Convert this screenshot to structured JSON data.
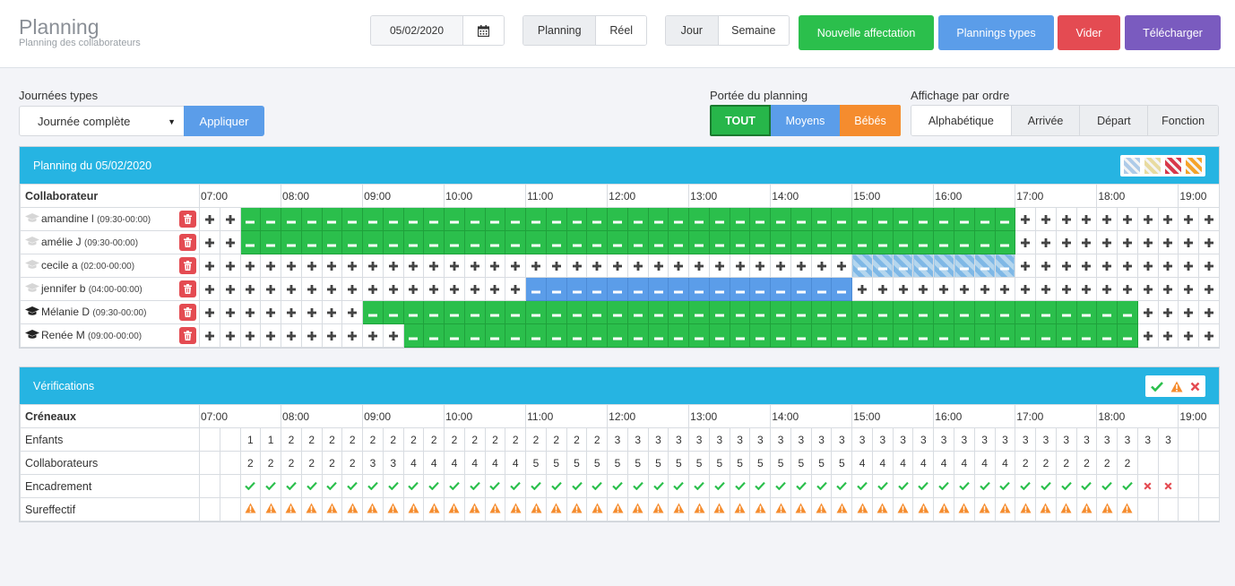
{
  "header": {
    "title": "Planning",
    "subtitle": "Planning des collaborateurs",
    "date_value": "05/02/2020",
    "view_tabs": [
      {
        "label": "Planning",
        "active": true
      },
      {
        "label": "Réel",
        "active": false
      }
    ],
    "period_tabs": [
      {
        "label": "Jour",
        "active": true
      },
      {
        "label": "Semaine",
        "active": false
      }
    ],
    "buttons": [
      {
        "label": "Nouvelle affectation",
        "color": "#2bbf4c"
      },
      {
        "label": "Plannings types",
        "color": "#5b9de9"
      },
      {
        "label": "Vider",
        "color": "#e44b52"
      },
      {
        "label": "Télécharger",
        "color": "#7a5bbf"
      }
    ]
  },
  "filters": {
    "journees_label": "Journées types",
    "journee_value": "Journée complète",
    "apply_label": "Appliquer",
    "portee_label": "Portée du planning",
    "portee_tabs": [
      {
        "label": "TOUT",
        "color": "#27b64a"
      },
      {
        "label": "Moyens",
        "color": "#5b9de9"
      },
      {
        "label": "Bébés",
        "color": "#f58c2e"
      }
    ],
    "affichage_label": "Affichage par ordre",
    "order_tabs": [
      {
        "label": "Alphabétique",
        "active": true
      },
      {
        "label": "Arrivée",
        "active": false
      },
      {
        "label": "Départ",
        "active": false
      },
      {
        "label": "Fonction",
        "active": false
      }
    ]
  },
  "planning": {
    "title": "Planning du 05/02/2020",
    "col_header": "Collaborateur",
    "hours": [
      "07:00",
      "08:00",
      "09:00",
      "10:00",
      "11:00",
      "12:00",
      "13:00",
      "14:00",
      "15:00",
      "16:00",
      "17:00",
      "18:00",
      "19:00"
    ],
    "legend_colors": [
      "#aecbe8",
      "#e8dba0",
      "#d8394a",
      "#f5a32a"
    ],
    "rows": [
      {
        "name": "amandine l",
        "hours": "(09:30-00:00)",
        "icon": "cap-light",
        "blocks": [
          {
            "from": 2,
            "to": 39,
            "type": "g"
          }
        ]
      },
      {
        "name": "amélie J",
        "hours": "(09:30-00:00)",
        "icon": "cap-light",
        "blocks": [
          {
            "from": 2,
            "to": 39,
            "type": "g"
          }
        ]
      },
      {
        "name": "cecile a",
        "hours": "(02:00-00:00)",
        "icon": "cap-light",
        "blocks": [
          {
            "from": 32,
            "to": 39,
            "type": "h"
          }
        ]
      },
      {
        "name": "jennifer b",
        "hours": "(04:00-00:00)",
        "icon": "cap-light",
        "blocks": [
          {
            "from": 16,
            "to": 31,
            "type": "b"
          }
        ]
      },
      {
        "name": "Mélanie D",
        "hours": "(09:30-00:00)",
        "icon": "cap-dark",
        "blocks": [
          {
            "from": 8,
            "to": 45,
            "type": "g"
          }
        ]
      },
      {
        "name": "Renée M",
        "hours": "(09:00-00:00)",
        "icon": "cap-dark",
        "blocks": [
          {
            "from": 10,
            "to": 45,
            "type": "g"
          }
        ]
      }
    ]
  },
  "verifications": {
    "title": "Vérifications",
    "col_header": "Créneaux",
    "row_labels": [
      "Enfants",
      "Collaborateurs",
      "Encadrement",
      "Sureffectif"
    ],
    "enfants": [
      "",
      "",
      "1",
      "1",
      "2",
      "2",
      "2",
      "2",
      "2",
      "2",
      "2",
      "2",
      "2",
      "2",
      "2",
      "2",
      "2",
      "2",
      "2",
      "2",
      "3",
      "3",
      "3",
      "3",
      "3",
      "3",
      "3",
      "3",
      "3",
      "3",
      "3",
      "3",
      "3",
      "3",
      "3",
      "3",
      "3",
      "3",
      "3",
      "3",
      "3",
      "3",
      "3",
      "3",
      "3",
      "3",
      "3",
      "3",
      "",
      ""
    ],
    "collaborateurs": [
      "",
      "",
      "2",
      "2",
      "2",
      "2",
      "2",
      "2",
      "3",
      "3",
      "4",
      "4",
      "4",
      "4",
      "4",
      "4",
      "5",
      "5",
      "5",
      "5",
      "5",
      "5",
      "5",
      "5",
      "5",
      "5",
      "5",
      "5",
      "5",
      "5",
      "5",
      "5",
      "4",
      "4",
      "4",
      "4",
      "4",
      "4",
      "4",
      "4",
      "2",
      "2",
      "2",
      "2",
      "2",
      "2",
      "",
      "",
      "",
      ""
    ],
    "encadrement": [
      "",
      "",
      "ok",
      "ok",
      "ok",
      "ok",
      "ok",
      "ok",
      "ok",
      "ok",
      "ok",
      "ok",
      "ok",
      "ok",
      "ok",
      "ok",
      "ok",
      "ok",
      "ok",
      "ok",
      "ok",
      "ok",
      "ok",
      "ok",
      "ok",
      "ok",
      "ok",
      "ok",
      "ok",
      "ok",
      "ok",
      "ok",
      "ok",
      "ok",
      "ok",
      "ok",
      "ok",
      "ok",
      "ok",
      "ok",
      "ok",
      "ok",
      "ok",
      "ok",
      "ok",
      "ok",
      "ko",
      "ko",
      "",
      ""
    ],
    "sureffectif": [
      "",
      "",
      "w",
      "w",
      "w",
      "w",
      "w",
      "w",
      "w",
      "w",
      "w",
      "w",
      "w",
      "w",
      "w",
      "w",
      "w",
      "w",
      "w",
      "w",
      "w",
      "w",
      "w",
      "w",
      "w",
      "w",
      "w",
      "w",
      "w",
      "w",
      "w",
      "w",
      "w",
      "w",
      "w",
      "w",
      "w",
      "w",
      "w",
      "w",
      "w",
      "w",
      "w",
      "w",
      "w",
      "w",
      "",
      "",
      "",
      ""
    ]
  },
  "colors": {
    "accent": "#26b4e2",
    "green": "#2bbf4c",
    "blue": "#5b9de9",
    "red": "#e44b52",
    "orange": "#f58c2e",
    "purple": "#7a5bbf"
  },
  "icons": [
    "calendar-icon",
    "graduation-cap-icon",
    "trash-icon",
    "plus-icon",
    "minus-icon",
    "check-icon",
    "warning-icon",
    "times-icon",
    "caret-down-icon"
  ]
}
